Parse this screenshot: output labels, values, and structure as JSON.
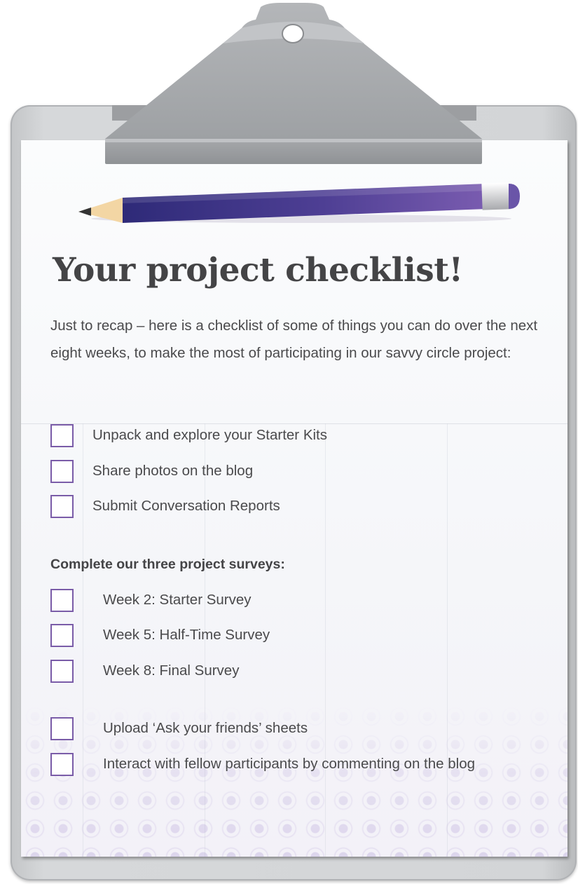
{
  "title": "Your project checklist!",
  "intro": "Just to recap – here is a checklist of some of things you can do over the next eight weeks, to make the most of participating in our savvy circle project:",
  "checklist": [
    {
      "label": "Unpack and explore your Starter Kits",
      "checked": false
    },
    {
      "label": "Share photos on the blog",
      "checked": false
    },
    {
      "label": "Submit Conversation Reports",
      "checked": false
    }
  ],
  "surveys": {
    "heading": "Complete our three project surveys:",
    "items": [
      {
        "label": "Week 2: Starter Survey",
        "checked": false
      },
      {
        "label": "Week 5: Half-Time Survey",
        "checked": false
      },
      {
        "label": "Week 8: Final Survey",
        "checked": false
      }
    ]
  },
  "extra": [
    {
      "label": "Upload ‘Ask your friends’ sheets",
      "checked": false
    },
    {
      "label": "Interact with fellow participants by commenting on the blog",
      "checked": false
    }
  ],
  "colors": {
    "checkbox_border": "#7a5ca8",
    "pencil_body": "#5b4a9e",
    "text": "#4a4a4c",
    "clipboard": "#c9cbcd"
  },
  "icons": [
    "clipboard-clip-icon",
    "pencil-icon",
    "checkbox-icon"
  ]
}
